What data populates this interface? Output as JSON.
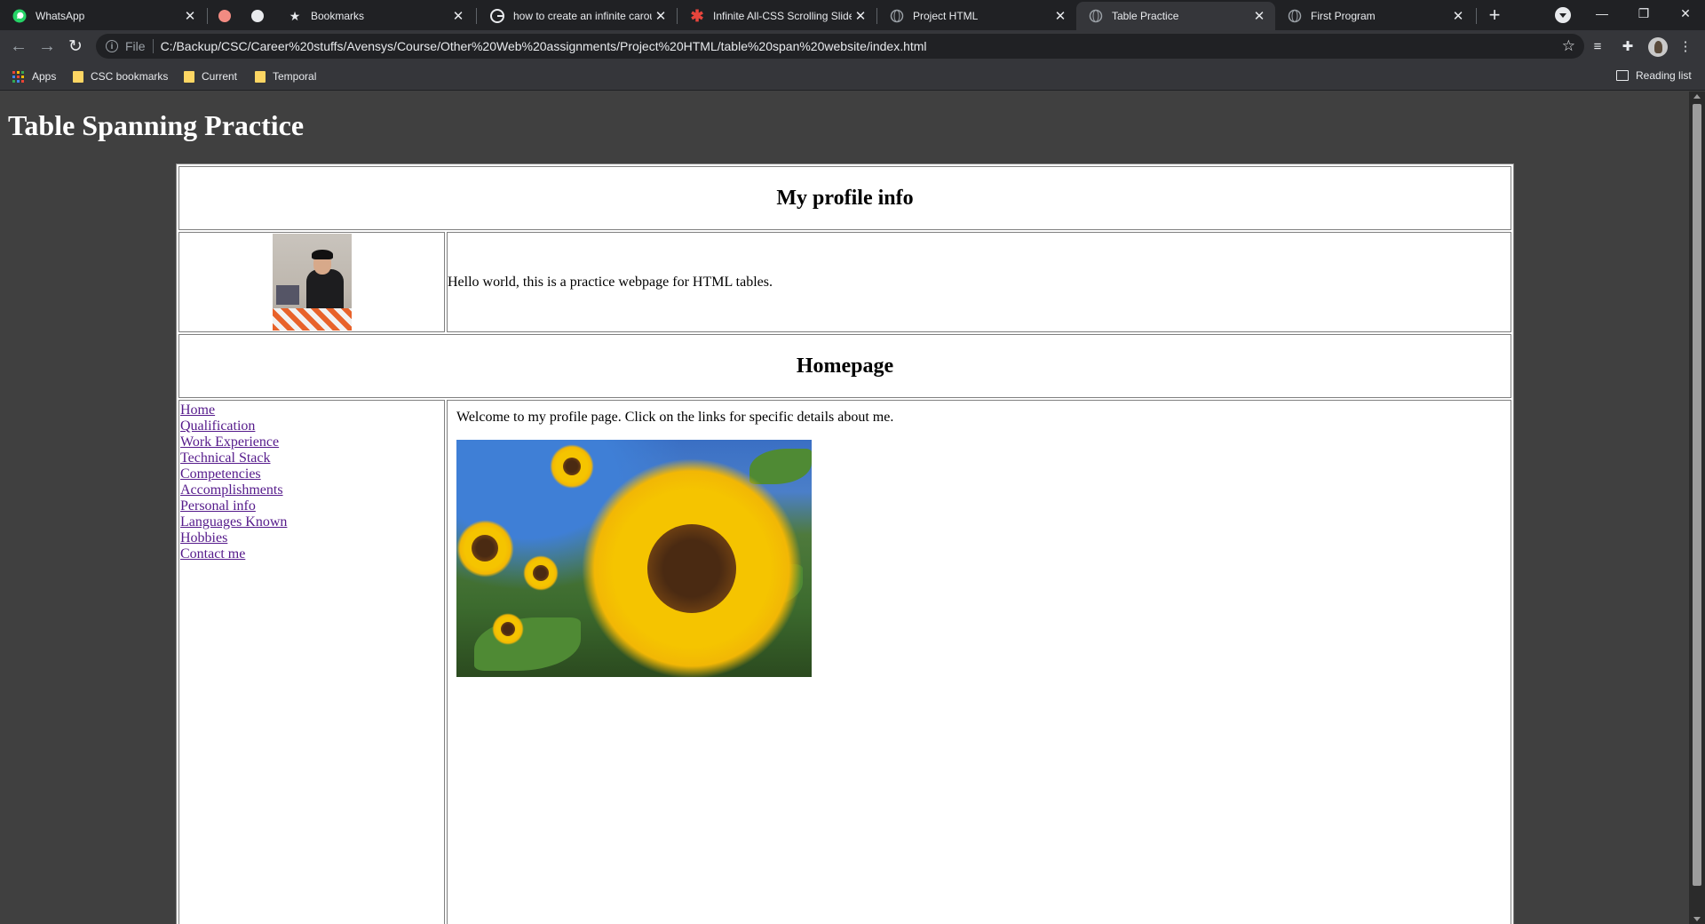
{
  "browser": {
    "tabs": [
      {
        "title": "WhatsApp",
        "icon": "whatsapp-icon"
      },
      {
        "title": "Bookmarks",
        "icon": "star-icon"
      },
      {
        "title": "how to create an infinite carou",
        "icon": "google-icon"
      },
      {
        "title": "Infinite All-CSS Scrolling Slide",
        "icon": "asterisk-icon"
      },
      {
        "title": "Project HTML",
        "icon": "globe-icon"
      },
      {
        "title": "Table Practice",
        "icon": "globe-icon"
      },
      {
        "title": "First Program",
        "icon": "globe-icon"
      }
    ],
    "active_tab": "Table Practice",
    "address": {
      "scheme_label": "File",
      "url": "C:/Backup/CSC/Career%20stuffs/Avensys/Course/Other%20Web%20assignments/Project%20HTML/table%20span%20website/index.html"
    },
    "bookmarks": [
      {
        "label": "Apps",
        "icon": "apps-grid-icon"
      },
      {
        "label": "CSC bookmarks",
        "icon": "folder-icon"
      },
      {
        "label": "Current",
        "icon": "folder-icon"
      },
      {
        "label": "Temporal",
        "icon": "folder-icon"
      }
    ],
    "reading_list": "Reading list"
  },
  "page": {
    "title": "Table Spanning Practice",
    "profile_heading": "My profile info",
    "intro_text": "Hello world, this is a practice webpage for HTML tables.",
    "home_heading": "Homepage",
    "nav_links": [
      "Home",
      "Qualification",
      "Work Experience",
      "Technical Stack",
      "Competencies",
      "Accomplishments",
      "Personal info",
      "Languages Known",
      "Hobbies",
      "Contact me"
    ],
    "welcome_text": "Welcome to my profile page. Click on the links for specific details about me."
  },
  "colors": {
    "page_bg": "#404040",
    "link": "#551a8b",
    "chrome_dark": "#202124",
    "chrome_toolbar": "#35363a"
  }
}
